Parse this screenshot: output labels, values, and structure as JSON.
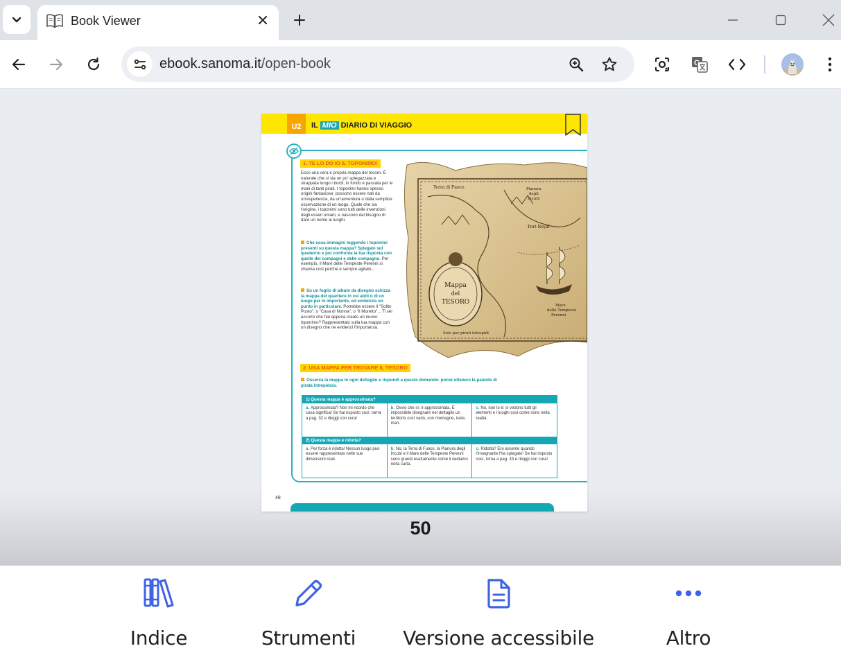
{
  "browser": {
    "tab_title": "Book Viewer",
    "url_domain": "ebook.sanoma.it",
    "url_path": "/open-book"
  },
  "page": {
    "unit": "U2",
    "title_pre": "IL",
    "title_mio": "MIO",
    "title_post": "DIARIO DI VIAGGIO",
    "section1_title": "1. TE LO DO IO IL TOPONIMO!",
    "section1_intro": "Ecco una vera e propria mappa del tesoro. È naturale che si sia un po' spiegazzata e strappata lungo i bordi, in fondo è passata per le mani di tanti pirati. I toponimi hanno spesso origini fantasiose: possono essere nati da un'esperienza, da un'avventura o dalla semplice osservazione di un luogo. Quale che sia l'origine, i toponimi sono tutti delle invenzioni degli esseri umani, e nascono dal bisogno di dare un nome ai luoghi.",
    "task1_bold": "Che cosa immagini leggendo i toponimi presenti su questa mappa? Spiegalo sul quaderno e poi confronta la tua risposta con quelle dei compagni e delle compagne.",
    "task1_rest": "Per esempio, il Mare delle Tempeste Perenni si chiama così perché è sempre agitato...",
    "task2_bold": "Su un foglio di album da disegno schizza la mappa del quartiere in cui abiti o di un luogo per te importante, ed evidenzia un punto in particolare.",
    "task2_rest": "Potrebbe essere il \"Solito Posto\", o \"Casa di Nonna\", o \"il Muretto\"... Ti sei accorto che hai appena creato un nuovo toponimo? Rappresentalo sulla tua mappa con un disegno che ne evidenzi l'importanza.",
    "map_labels": {
      "top_left": "Terra di Fuoco",
      "top_right": "Pianura degli Incubi",
      "port": "Port Royal",
      "cartouche": "Mappa del TESORO",
      "sea": "Mare delle Tempeste Perenni",
      "bottom": "Solo per pirati intrepidi"
    },
    "section2_title": "2. UNA MAPPA PER TROVARE IL TESORO",
    "section2_task": "Osserva la mappa in ogni dettaglio e rispondi a queste domande: potrai ottenere la patente di pirata intrepido/a.",
    "q1": "1) Questa mappa è approssimata?",
    "q1_a": "Approssimata? Non mi ricordo che cosa significa! Se hai risposto così, torna a pag. 32 e rileggi con cura!",
    "q1_b": "Ovvio che sì: è approssimata. È impossibile disegnare nel dettaglio un territorio così vario, con montagne, isole, mari.",
    "q1_c": "No, non lo è: si vedono tutti gli elementi e i luoghi così come sono nella realtà.",
    "q2": "2) Questa mappa è ridotta?",
    "q2_a": "Per forza è ridotta! Nessun luogo può essere rappresentato nelle sue dimensioni reali.",
    "q2_b": "No, la Terra di Fuoco, la Pianura degli Incubi e il Mare delle Tempeste Perenni sono grandi esattamente come li vediamo nella carta.",
    "q2_c": "Ridotta? Ero assente quando l'insegnante l'ha spiegato! Se hai risposto così, torna a pag. 33 e rileggi con cura!",
    "opt_a": "a.",
    "opt_b": "b.",
    "opt_c": "c.",
    "folio": "48"
  },
  "viewer": {
    "page_number": "50"
  },
  "bottom_nav": {
    "index": "Indice",
    "tools": "Strumenti",
    "accessible": "Versione accessibile",
    "more": "Altro"
  },
  "colors": {
    "accent_blue": "#3f63e6",
    "page_yellow": "#ffe600",
    "page_teal": "#15a7b4"
  },
  "icons": [
    "chevron-down-icon",
    "book-icon",
    "close-icon",
    "plus-icon",
    "minimize-icon",
    "maximize-icon",
    "back-icon",
    "forward-icon",
    "reload-icon",
    "site-info-icon",
    "zoom-icon",
    "star-icon",
    "lens-icon",
    "translate-icon",
    "code-icon",
    "menu-icon",
    "books-icon",
    "pencil-icon",
    "document-icon",
    "more-icon"
  ]
}
